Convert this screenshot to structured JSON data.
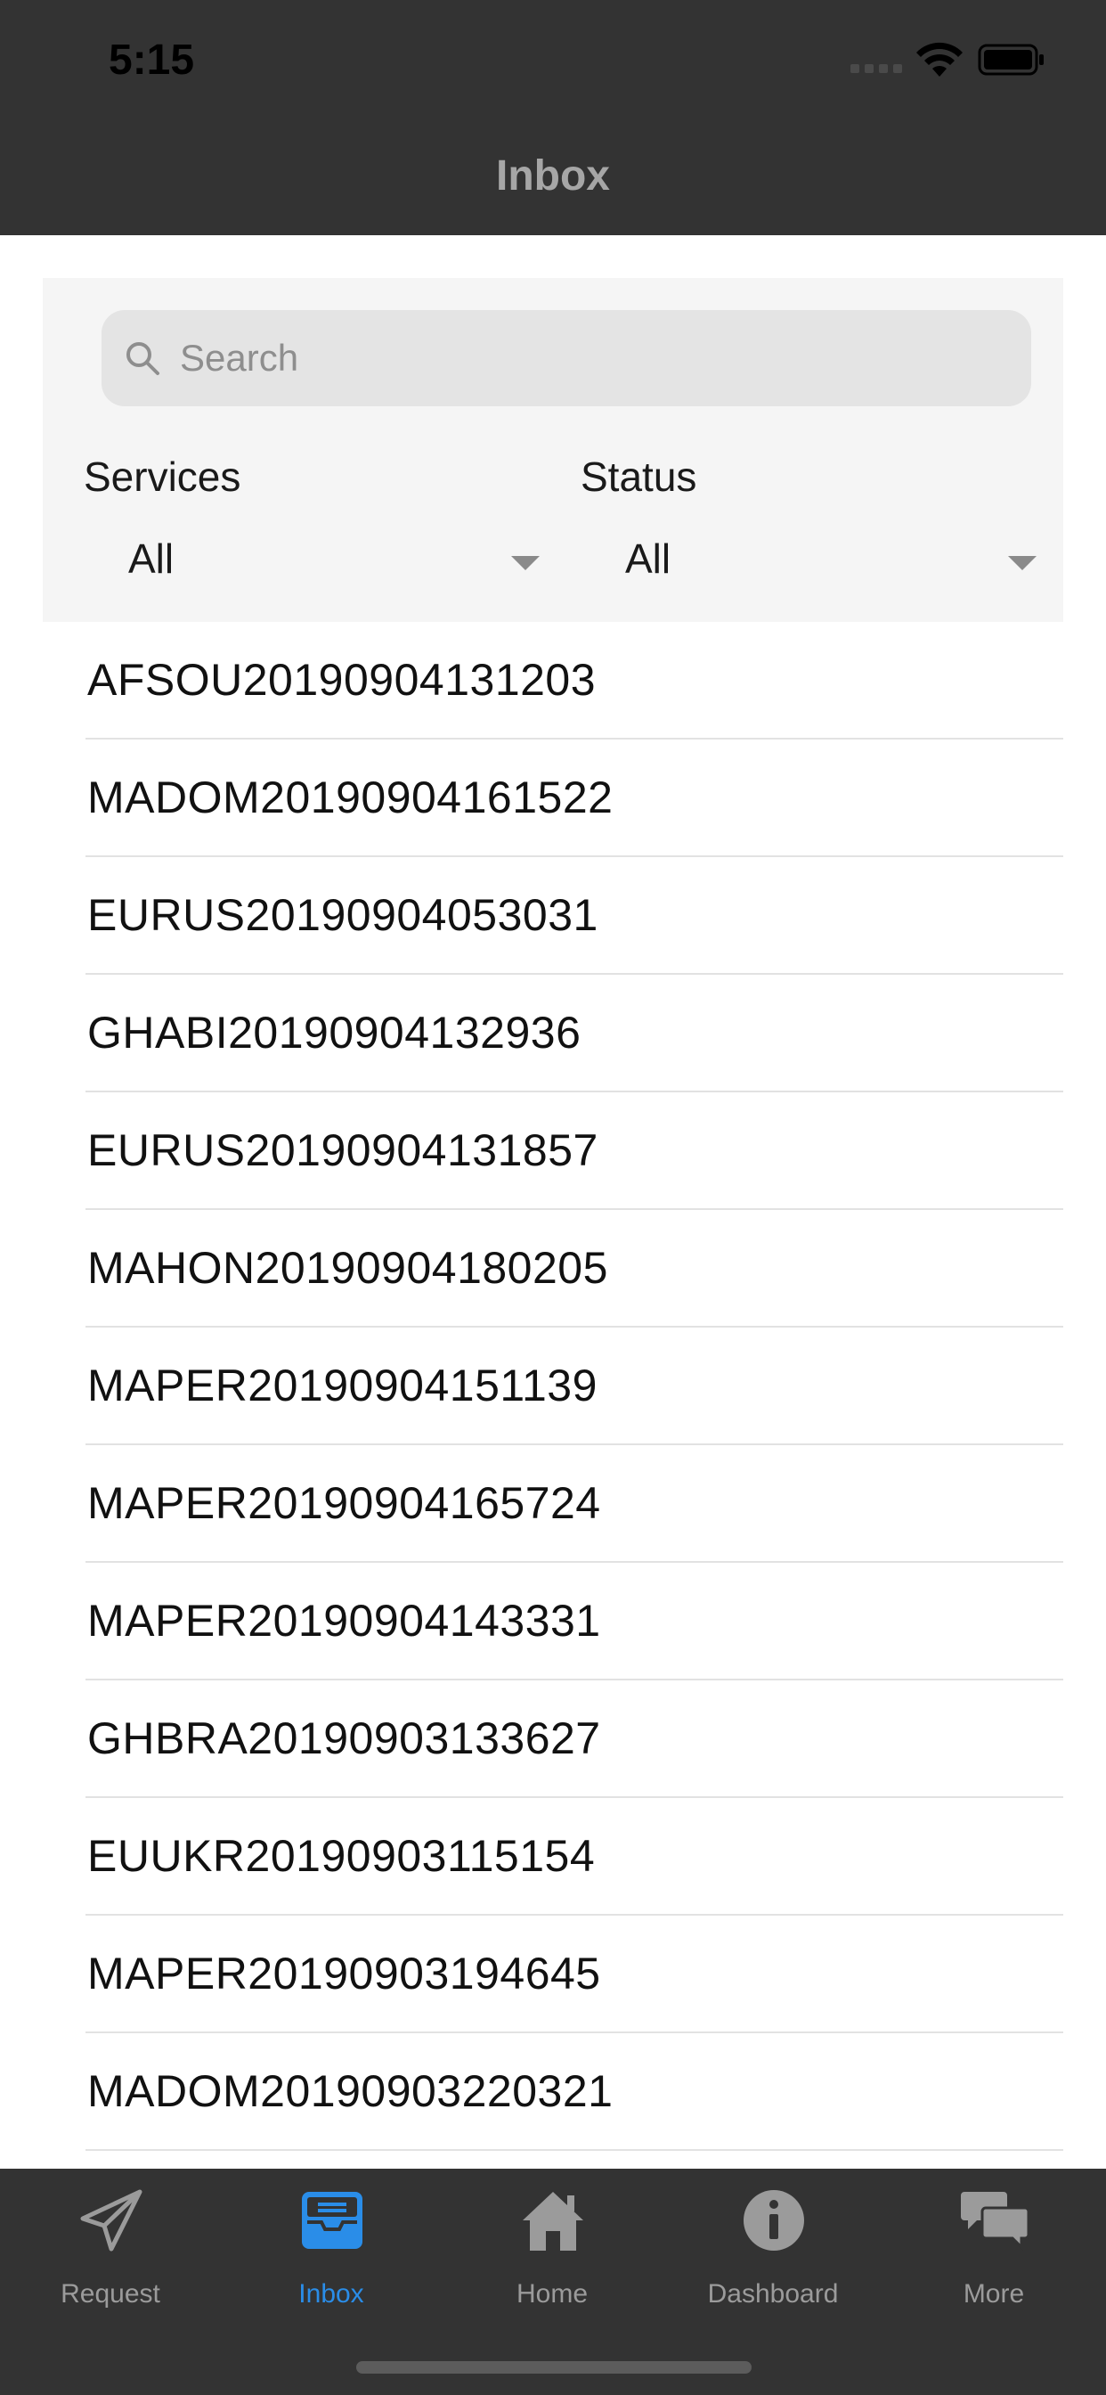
{
  "status_bar": {
    "time": "5:15"
  },
  "nav": {
    "title": "Inbox"
  },
  "filters": {
    "search_placeholder": "Search",
    "services_label": "Services",
    "services_value": "All",
    "status_label": "Status",
    "status_value": "All"
  },
  "list": {
    "items": [
      "AFSOU20190904131203",
      "MADOM20190904161522",
      "EURUS20190904053031",
      "GHABI20190904132936",
      "EURUS20190904131857",
      "MAHON20190904180205",
      "MAPER20190904151139",
      "MAPER20190904165724",
      "MAPER20190904143331",
      "GHBRA20190903133627",
      "EUUKR20190903115154",
      "MAPER20190903194645",
      "MADOM20190903220321"
    ]
  },
  "tab_bar": {
    "active": "Inbox",
    "accent_color": "#2a8de8",
    "tabs": [
      {
        "label": "Request",
        "icon": "paper-plane-icon"
      },
      {
        "label": "Inbox",
        "icon": "inbox-tray-icon"
      },
      {
        "label": "Home",
        "icon": "house-icon"
      },
      {
        "label": "Dashboard",
        "icon": "info-circle-icon"
      },
      {
        "label": "More",
        "icon": "chat-bubbles-icon"
      }
    ]
  },
  "colors": {
    "header_bg": "#333333",
    "panel_bg": "#f5f5f5",
    "search_bg": "#e4e4e4"
  }
}
